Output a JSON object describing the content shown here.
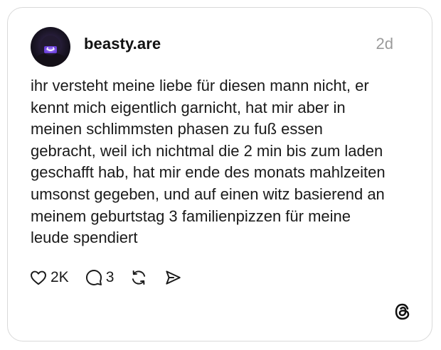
{
  "post": {
    "username": "beasty.are",
    "timestamp": "2d",
    "text_lines": [
      "ihr versteht meine liebe für diesen mann nicht,  er",
      "kennt mich eigentlich garnicht, hat mir aber in",
      "meinen schlimmsten phasen zu fuß essen",
      "gebracht, weil ich nichtmal die 2 min bis zum laden",
      "geschafft hab, hat mir ende des monats mahlzeiten",
      "umsonst gegeben, und auf einen witz basierend an",
      "meinem geburtstag 3 familienpizzen für meine",
      "leude spendiert"
    ]
  },
  "actions": {
    "like_count": "2K",
    "reply_count": "3"
  },
  "icons": {
    "like": "heart-icon",
    "reply": "comment-icon",
    "repost": "repost-icon",
    "share": "send-icon",
    "brand": "threads-logo-icon"
  },
  "colors": {
    "text": "#1a1a1a",
    "muted": "#9a9a9a",
    "border": "#d9d9d9",
    "avatar_accent": "#8a5cff"
  }
}
